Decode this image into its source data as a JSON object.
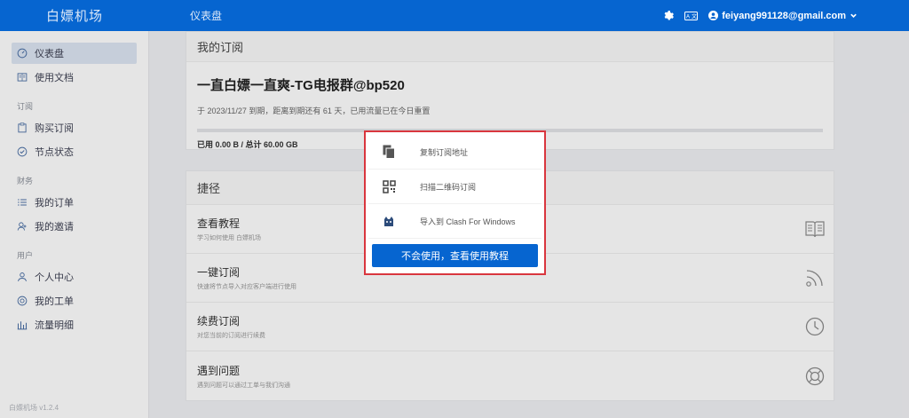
{
  "header": {
    "brand": "白嫖机场",
    "page_title": "仪表盘",
    "user_email": "feiyang991128@gmail.com"
  },
  "sidebar": {
    "top_items": [
      {
        "label": "仪表盘",
        "icon": "dashboard-icon"
      },
      {
        "label": "使用文档",
        "icon": "book-icon"
      }
    ],
    "groups": [
      {
        "title": "订阅",
        "items": [
          {
            "label": "购买订阅",
            "icon": "clipboard-icon"
          },
          {
            "label": "节点状态",
            "icon": "check-circle-icon"
          }
        ]
      },
      {
        "title": "财务",
        "items": [
          {
            "label": "我的订单",
            "icon": "list-icon"
          },
          {
            "label": "我的邀请",
            "icon": "invite-icon"
          }
        ]
      },
      {
        "title": "用户",
        "items": [
          {
            "label": "个人中心",
            "icon": "user-icon"
          },
          {
            "label": "我的工单",
            "icon": "support-icon"
          },
          {
            "label": "流量明细",
            "icon": "bar-chart-icon"
          }
        ]
      }
    ],
    "version": "白嫖机场 v1.2.4"
  },
  "subscription": {
    "card_title": "我的订阅",
    "plan_name": "一直白嫖一直爽-TG电报群@bp520",
    "expiry_desc": "于 2023/11/27 到期，距离到期还有 61 天，已用流量已在今日重置",
    "usage": "已用 0.00 B / 总计 60.00 GB",
    "progress": 0
  },
  "shortcuts": {
    "card_title": "捷径",
    "items": [
      {
        "title": "查看教程",
        "desc": "学习如何使用 白嫖机场"
      },
      {
        "title": "一键订阅",
        "desc": "快速将节点导入对应客户端进行使用"
      },
      {
        "title": "续费订阅",
        "desc": "对您当前的订阅进行续费"
      },
      {
        "title": "遇到问题",
        "desc": "遇到问题可以通过工单与我们沟通"
      }
    ]
  },
  "popup": {
    "items": [
      {
        "label": "复制订阅地址",
        "icon": "copy-icon"
      },
      {
        "label": "扫描二维码订阅",
        "icon": "qrcode-icon"
      },
      {
        "label": "导入到 Clash For Windows",
        "icon": "clash-cat-icon"
      }
    ],
    "button": "不会使用，查看使用教程"
  },
  "colors": {
    "primary": "#0665d0",
    "highlight_border": "#d9363e"
  }
}
